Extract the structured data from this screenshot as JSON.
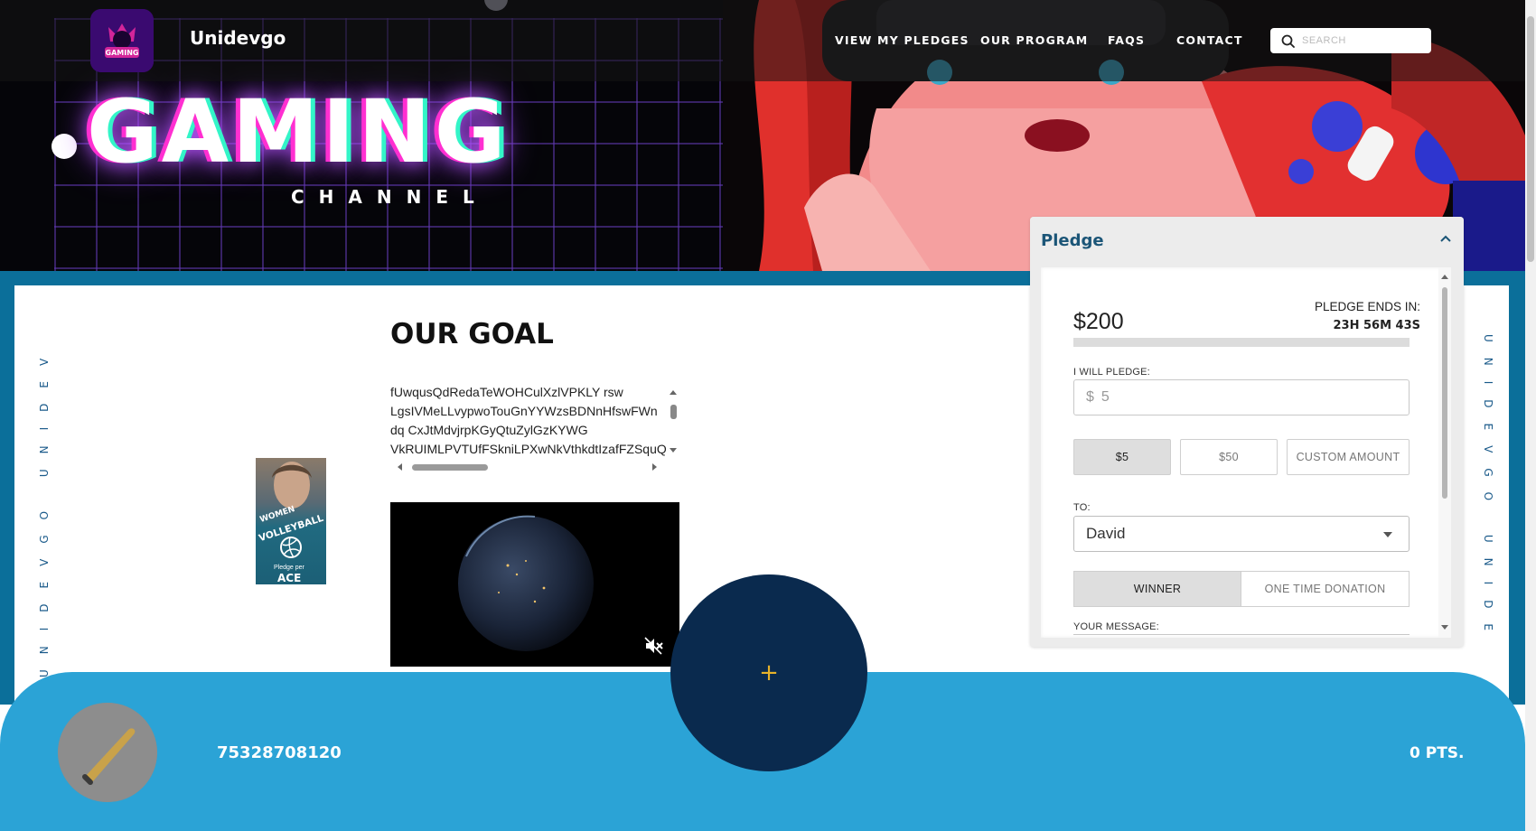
{
  "brand": {
    "name": "Unidevgo",
    "logo_text": "GAMING"
  },
  "nav": {
    "links": [
      "VIEW MY PLEDGES",
      "OUR PROGRAM",
      "FAQS",
      "CONTACT"
    ],
    "search_placeholder": "SEARCH"
  },
  "hero": {
    "title": "GAMING",
    "subtitle": "CHANNEL"
  },
  "side_text": {
    "left": "UNIDEVGO UNIDEV",
    "right": "UNIDEVGO UNIDE"
  },
  "goal": {
    "title": "OUR GOAL",
    "text_lines": [
      "fUwqusQdRedaTeWOHCulXzlVPKLY rsw",
      "LgsIVMeLLvypwoTouGnYYWzsBDNnHfswFWn",
      "dq CxJtMdvjrpKGyQtuZylGzKYWG",
      "VkRUIMLPVTUfFSkniLPXwNkVthkdtIzafFZSquQ"
    ]
  },
  "ad": {
    "line1": "WOMEN",
    "line2": "VOLLEYBALL",
    "line3": "Pledge per",
    "line4": "ACE"
  },
  "pledge": {
    "title": "Pledge",
    "amount": "$200",
    "ends_label": "PLEDGE ENDS IN:",
    "ends_time": "23H 56M 43S",
    "progress_fraction": 0.0,
    "will_pledge_label": "I WILL PLEDGE:",
    "currency": "$",
    "input_value": "5",
    "amount_buttons": [
      "$5",
      "$50",
      "CUSTOM AMOUNT"
    ],
    "selected_amount": "$5",
    "to_label": "TO:",
    "to_value": "David",
    "type_options": [
      "WINNER",
      "ONE TIME DONATION"
    ],
    "selected_type": "WINNER",
    "message_label": "YOUR MESSAGE:"
  },
  "footer": {
    "user_id": "75328708120",
    "points": "0 PTS.",
    "fab_symbol": "+"
  },
  "colors": {
    "frame_blue": "#0b6f9a",
    "footer_blue": "#2ba3d6",
    "fab_navy": "#0a2a4e",
    "pledge_title": "#1b5577",
    "plus_gold": "#e7b22a"
  }
}
